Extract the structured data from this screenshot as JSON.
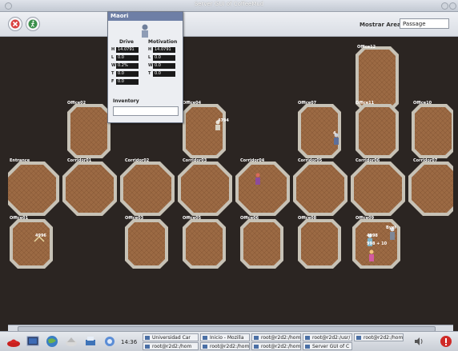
{
  "window": {
    "title": "Server GUI of CoffeeMud"
  },
  "toolbar": {
    "area_label": "Mostrar Area:",
    "area_value": "Passage"
  },
  "agent_panel": {
    "name": "Maori",
    "drive_header": "Drive",
    "motivation_header": "Motivation",
    "drive_rows": [
      {
        "key": "H",
        "value": "14.0791"
      },
      {
        "key": "L",
        "value": "0.0"
      },
      {
        "key": "W",
        "value": "0.2%"
      },
      {
        "key": "T",
        "value": "0.0"
      },
      {
        "key": "F",
        "value": "0.0"
      }
    ],
    "motivation_rows": [
      {
        "key": "H",
        "value": "14.0791"
      },
      {
        "key": "L",
        "value": "0.0"
      },
      {
        "key": "W",
        "value": "0.0"
      },
      {
        "key": "T",
        "value": "0.0"
      }
    ],
    "inventory_label": "Inventory",
    "inventory_value": ""
  },
  "rooms": {
    "office12": "Office12",
    "office02": "Office02",
    "office04": "Office04",
    "office07": "Office07",
    "office11": "Office11",
    "office10": "Office10",
    "entrance": "Entrance",
    "corridor01": "Corridor01",
    "corridor02": "Corridor02",
    "corridor03": "Corridor03",
    "corridor04": "Corridor04",
    "corridor05": "Corridor05",
    "corridor06": "Corridor06",
    "corridor07": "Corridor07",
    "office01": "Office01",
    "office03": "Office03",
    "office05": "Office05",
    "office06": "Office06",
    "office08": "Office08",
    "office09": "Office09"
  },
  "agent_tags": {
    "o4": "4794",
    "o1": "4996",
    "o7": "4",
    "o9a": "4998",
    "o9b": "Byel",
    "o9c": "998 + 10"
  },
  "taskbar": {
    "clock": "14:36",
    "tasks": [
      "Universidad Car",
      "Inicio - Mozilla",
      "root@r2d2:/hom",
      "root@r2d2:/usr/",
      "root@r2d2:/hom",
      "root@r2d2:/hom",
      "root@r2d2:/hom",
      "root@r2d2:/hom",
      "Server GUI of C"
    ]
  }
}
